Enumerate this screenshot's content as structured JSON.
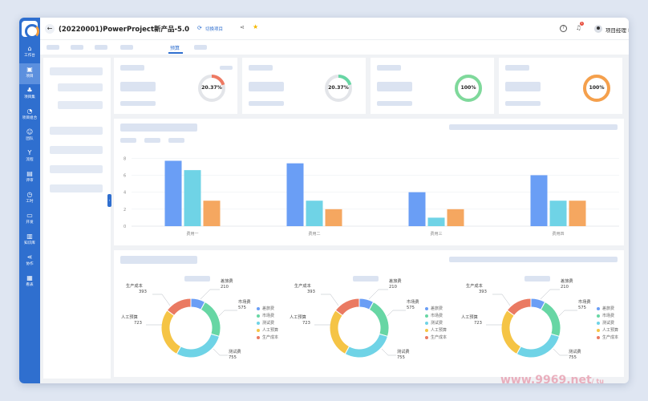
{
  "app": {
    "title": "(20220001)PowerProject新产品-5.0",
    "switch_label": "切换项目",
    "user_name": "项目经理 PM",
    "notification_count": "1"
  },
  "sidebar": {
    "items": [
      {
        "label": "工作台",
        "icon": "home-icon",
        "glyph": "⌂"
      },
      {
        "label": "项目",
        "icon": "project-icon",
        "glyph": "▣"
      },
      {
        "label": "项目集",
        "icon": "program-icon",
        "glyph": "♣"
      },
      {
        "label": "项目组合",
        "icon": "portfolio-icon",
        "glyph": "◔"
      },
      {
        "label": "团队",
        "icon": "team-icon",
        "glyph": "☺"
      },
      {
        "label": "流程",
        "icon": "flow-icon",
        "glyph": "Y"
      },
      {
        "label": "评审",
        "icon": "review-icon",
        "glyph": "▤"
      },
      {
        "label": "工时",
        "icon": "clock-icon",
        "glyph": "◷"
      },
      {
        "label": "开发",
        "icon": "dev-icon",
        "glyph": "▭"
      },
      {
        "label": "知识库",
        "icon": "book-icon",
        "glyph": "▥"
      },
      {
        "label": "协作",
        "icon": "share-icon",
        "glyph": "⋖"
      },
      {
        "label": "看表",
        "icon": "report-icon",
        "glyph": "▦"
      }
    ]
  },
  "tabs": {
    "active": "预算"
  },
  "gauges": [
    {
      "value": "20.37%",
      "percent": 20.37,
      "color": "#ee7a63"
    },
    {
      "value": "20.37%",
      "percent": 20.37,
      "color": "#67d6a4"
    },
    {
      "value": "100%",
      "percent": 100,
      "color": "#7fd99b"
    },
    {
      "value": "100%",
      "percent": 100,
      "color": "#f5a04c"
    }
  ],
  "chart_data": [
    {
      "type": "bar",
      "categories": [
        "费用一",
        "费用二",
        "费用三",
        "费用四"
      ],
      "series": [
        {
          "values": [
            7.7,
            7.4,
            4,
            6
          ],
          "color": "#6a9ef5"
        },
        {
          "values": [
            6.6,
            3,
            1,
            3
          ],
          "color": "#6fd3e6"
        },
        {
          "values": [
            3,
            2,
            2,
            3
          ],
          "color": "#f5a760"
        }
      ],
      "yticks": [
        "0",
        "2",
        "4",
        "6",
        "8"
      ],
      "ylim": [
        0,
        8.5
      ]
    },
    {
      "type": "pie",
      "slices": [
        {
          "name": "差旅费",
          "value": 210
        },
        {
          "name": "市场费",
          "value": 575
        },
        {
          "name": "测试费",
          "value": 755
        },
        {
          "name": "人工预算",
          "value": 723
        },
        {
          "name": "生产成本",
          "value": 393
        }
      ]
    },
    {
      "type": "pie",
      "slices": [
        {
          "name": "差旅费",
          "value": 210
        },
        {
          "name": "市场费",
          "value": 575
        },
        {
          "name": "测试费",
          "value": 755
        },
        {
          "name": "人工预算",
          "value": 723
        },
        {
          "name": "生产成本",
          "value": 393
        }
      ]
    },
    {
      "type": "pie",
      "slices": [
        {
          "name": "差旅费",
          "value": 210
        },
        {
          "name": "市场费",
          "value": 575
        },
        {
          "name": "测试费",
          "value": 755
        },
        {
          "name": "人工预算",
          "value": 723
        },
        {
          "name": "生产成本",
          "value": 393
        }
      ]
    }
  ],
  "pie_colors": [
    "#6a9ef5",
    "#67d6a4",
    "#6fd3e6",
    "#f5c445",
    "#ea7a62"
  ],
  "watermark": {
    "text": "www.9969.net",
    "suffix": "/ tu"
  }
}
